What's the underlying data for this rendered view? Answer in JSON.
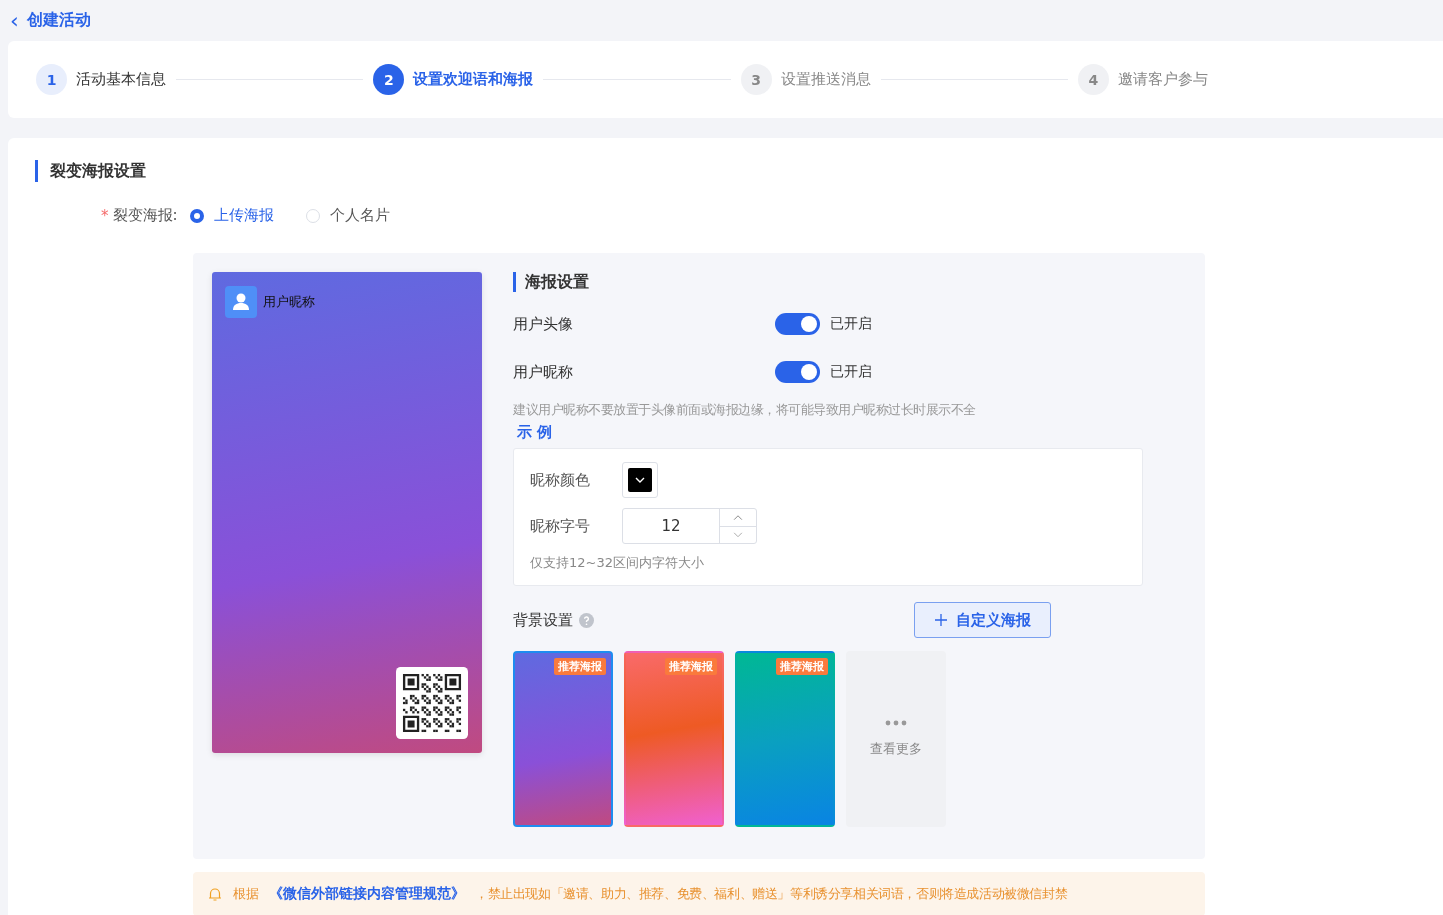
{
  "header": {
    "back_icon": "‹",
    "title": "创建活动"
  },
  "steps": [
    {
      "number": "1",
      "label": "活动基本信息",
      "completed": true,
      "selected": false
    },
    {
      "number": "2",
      "label": "设置欢迎语和海报",
      "completed": false,
      "selected": true
    },
    {
      "number": "3",
      "label": "设置推送消息",
      "completed": false,
      "selected": false
    },
    {
      "number": "4",
      "label": "邀请客户参与",
      "completed": false,
      "selected": false
    }
  ],
  "section_title": "裂变海报设置",
  "poster_type": {
    "required_mark": "*",
    "label": "裂变海报:",
    "options": [
      {
        "label": "上传海报",
        "selected": true
      },
      {
        "label": "个人名片",
        "selected": false
      }
    ]
  },
  "preview": {
    "nickname": "用户昵称"
  },
  "poster_settings": {
    "title": "海报设置",
    "toggles": [
      {
        "label": "用户头像",
        "on": true,
        "state_text": "已开启"
      },
      {
        "label": "用户昵称",
        "on": true,
        "state_text": "已开启"
      }
    ],
    "hint": "建议用户昵称不要放置于头像前面或海报边缘，将可能导致用户昵称过长时展示不全",
    "example_link": "示 例",
    "nickname_color": {
      "label": "昵称颜色",
      "color": "#000000"
    },
    "nickname_size": {
      "label": "昵称字号",
      "value": "12",
      "hint": "仅支持12~32区间内字符大小"
    },
    "background": {
      "label": "背景设置",
      "custom_button": "自定义海报",
      "items": [
        {
          "kind": "poster",
          "badge": "推荐海报",
          "selected": true
        },
        {
          "kind": "poster",
          "badge": "推荐海报",
          "selected": false
        },
        {
          "kind": "poster",
          "badge": "推荐海报",
          "selected": false
        },
        {
          "kind": "more",
          "label": "查看更多",
          "selected": false
        }
      ]
    }
  },
  "notice": {
    "prefix": "根据",
    "link": "《微信外部链接内容管理规范》",
    "text": "，禁止出现如「邀请、助力、推荐、免费、福利、赠送」等利诱分享相关词语，否则将造成活动被微信封禁"
  }
}
